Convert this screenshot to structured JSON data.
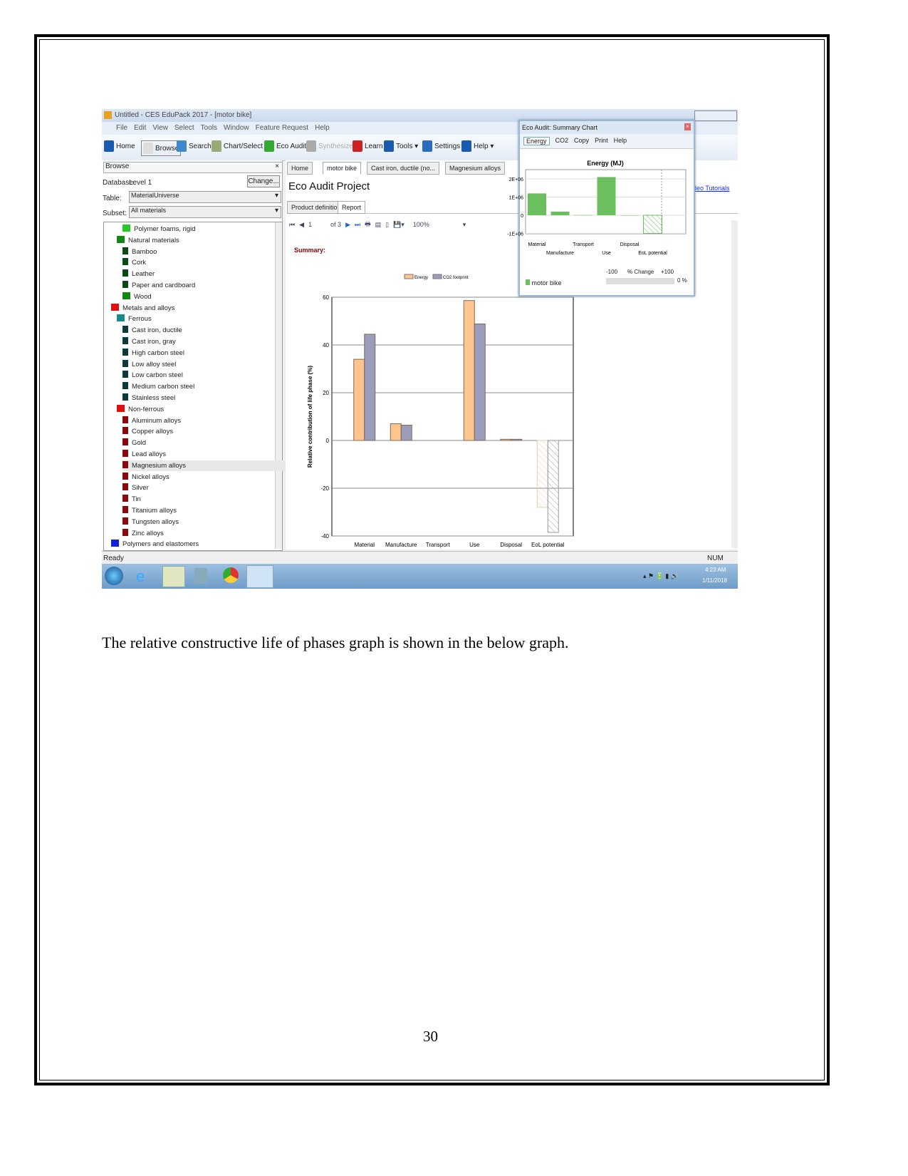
{
  "window": {
    "title": "Untitled - CES EduPack 2017 - [motor bike]",
    "menu": [
      "File",
      "Edit",
      "View",
      "Select",
      "Tools",
      "Window",
      "Feature Request",
      "Help"
    ],
    "toolbar": [
      "Home",
      "Browse",
      "Search",
      "Chart/Select",
      "Eco Audit",
      "Synthesizer",
      "Learn",
      "Tools ▾",
      "Settings",
      "Help ▾"
    ]
  },
  "browse": {
    "title": "Browse",
    "close": "×",
    "database_label": "Database:",
    "database_value": "Level 1",
    "change": "Change...",
    "table_label": "Table:",
    "table_value": "MaterialUniverse",
    "subset_label": "Subset:",
    "subset_value": "All materials",
    "tree": [
      {
        "label": "Polymer foams, rigid",
        "level": 2,
        "color": "#22cc22",
        "folder": true
      },
      {
        "label": "Natural materials",
        "level": 1,
        "color": "#118811",
        "folder": true
      },
      {
        "label": "Bamboo",
        "level": 2,
        "color": "#0a4a1a"
      },
      {
        "label": "Cork",
        "level": 2,
        "color": "#0a4a1a"
      },
      {
        "label": "Leather",
        "level": 2,
        "color": "#0a4a1a"
      },
      {
        "label": "Paper and cardboard",
        "level": 2,
        "color": "#0a4a1a"
      },
      {
        "label": "Wood",
        "level": 2,
        "color": "#118811",
        "folder": true
      },
      {
        "label": "Metals and alloys",
        "level": 0,
        "color": "#dd1111",
        "folder": true
      },
      {
        "label": "Ferrous",
        "level": 1,
        "color": "#1a8a8a",
        "folder": true
      },
      {
        "label": "Cast iron, ductile",
        "level": 2,
        "color": "#0a3a3a"
      },
      {
        "label": "Cast iron, gray",
        "level": 2,
        "color": "#0a3a3a"
      },
      {
        "label": "High carbon steel",
        "level": 2,
        "color": "#0a3a3a"
      },
      {
        "label": "Low alloy steel",
        "level": 2,
        "color": "#0a3a3a"
      },
      {
        "label": "Low carbon steel",
        "level": 2,
        "color": "#0a3a3a"
      },
      {
        "label": "Medium carbon steel",
        "level": 2,
        "color": "#0a3a3a"
      },
      {
        "label": "Stainless steel",
        "level": 2,
        "color": "#0a3a3a"
      },
      {
        "label": "Non-ferrous",
        "level": 1,
        "color": "#dd1111",
        "folder": true
      },
      {
        "label": "Aluminum alloys",
        "level": 2,
        "color": "#8a0a0a"
      },
      {
        "label": "Copper alloys",
        "level": 2,
        "color": "#8a0a0a"
      },
      {
        "label": "Gold",
        "level": 2,
        "color": "#8a0a0a"
      },
      {
        "label": "Lead alloys",
        "level": 2,
        "color": "#8a0a0a"
      },
      {
        "label": "Magnesium alloys",
        "level": 2,
        "color": "#8a0a0a",
        "selected": true
      },
      {
        "label": "Nickel alloys",
        "level": 2,
        "color": "#8a0a0a"
      },
      {
        "label": "Silver",
        "level": 2,
        "color": "#8a0a0a"
      },
      {
        "label": "Tin",
        "level": 2,
        "color": "#8a0a0a"
      },
      {
        "label": "Titanium alloys",
        "level": 2,
        "color": "#8a0a0a"
      },
      {
        "label": "Tungsten alloys",
        "level": 2,
        "color": "#8a0a0a"
      },
      {
        "label": "Zinc alloys",
        "level": 2,
        "color": "#8a0a0a"
      },
      {
        "label": "Polymers and elastomers",
        "level": 0,
        "color": "#1122dd",
        "folder": true
      }
    ]
  },
  "tabs": [
    "Home",
    "motor bike",
    "Cast iron, ductile (no...",
    "Magnesium alloys"
  ],
  "project": {
    "title": "Eco Audit Project",
    "subtabs": [
      "Product definition",
      "Report"
    ],
    "page": "1",
    "of": "of 3",
    "zoom": "100%",
    "summary": "Summary:",
    "video_tutorials": "deo Tutorials"
  },
  "chart_data": [
    {
      "type": "bar",
      "title": "",
      "ylabel": "Relative contribution of life phase (%)",
      "ylim": [
        -40,
        60
      ],
      "yticks": [
        -40,
        -20,
        0,
        20,
        40,
        60
      ],
      "grid": true,
      "legend": "top",
      "categories": [
        "Material",
        "Manufacture",
        "Transport",
        "Use",
        "Disposal",
        "EoL potential"
      ],
      "series": [
        {
          "name": "Energy",
          "color": "#ffc58e",
          "values": [
            34,
            7,
            0,
            58.6,
            0.5,
            -28
          ]
        },
        {
          "name": "CO2 footprint",
          "color": "#9c9cbc",
          "values": [
            44.5,
            6.4,
            0,
            48.8,
            0.5,
            -38.5
          ]
        }
      ],
      "hatched_category": "EoL potential"
    },
    {
      "type": "bar",
      "title": "Energy (MJ)",
      "ylim": [
        -1000000,
        2000000
      ],
      "yticks": [
        "-1E+06",
        "0",
        "1E+06",
        "2E+06"
      ],
      "color": "#6cbf5e",
      "categories": [
        "Material",
        "Manufacture",
        "Transport",
        "Use",
        "Disposal",
        "EoL potential"
      ],
      "values": [
        1200000,
        200000,
        10000,
        2100000,
        0,
        -1000000
      ],
      "legend": "motor bike"
    }
  ],
  "popup": {
    "title": "Eco Audit: Summary Chart",
    "buttons": [
      "Energy",
      "CO2",
      "Copy",
      "Print",
      "Help"
    ],
    "change_min": "-100",
    "change_label": "% Change",
    "change_max": "+100",
    "change_value": "0 %"
  },
  "status": {
    "left": "Ready",
    "right": "NUM"
  },
  "clock": {
    "time": "4:23 AM",
    "date": "1/11/2018"
  },
  "caption": "The relative constructive life of phases graph is shown in the below graph.",
  "page_number": "30"
}
